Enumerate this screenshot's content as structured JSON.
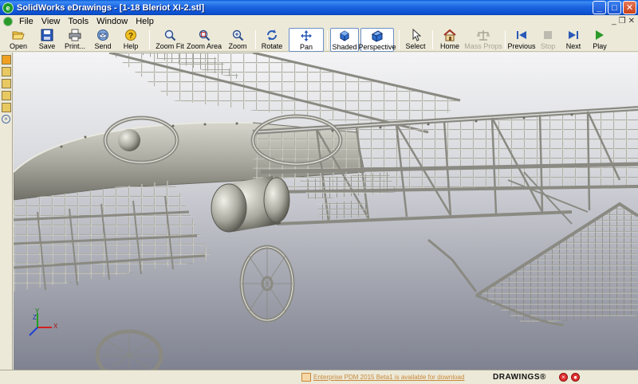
{
  "window": {
    "title": "SolidWorks eDrawings - [1-18 Bleriot XI-2.stl]",
    "app_icon": "edrawings-icon",
    "controls": [
      "minimize-icon",
      "maximize-icon",
      "close-icon"
    ]
  },
  "menu": {
    "items": [
      "File",
      "View",
      "Tools",
      "Window",
      "Help"
    ]
  },
  "toolbar": {
    "buttons": [
      {
        "label": "Open",
        "icon": "open-folder-icon"
      },
      {
        "label": "Save",
        "icon": "save-disk-icon"
      },
      {
        "label": "Print...",
        "icon": "printer-icon"
      },
      {
        "label": "Send",
        "icon": "send-mail-icon"
      },
      {
        "label": "Help",
        "icon": "help-icon"
      },
      {
        "label": "Zoom Fit",
        "icon": "zoom-fit-icon"
      },
      {
        "label": "Zoom Area",
        "icon": "zoom-area-icon"
      },
      {
        "label": "Zoom",
        "icon": "zoom-icon"
      },
      {
        "label": "Rotate",
        "icon": "rotate-icon"
      },
      {
        "label": "Pan",
        "icon": "pan-icon",
        "active": true
      },
      {
        "label": "Shaded",
        "icon": "shaded-cube-icon",
        "active": true
      },
      {
        "label": "Perspective",
        "icon": "perspective-cube-icon",
        "active": true
      },
      {
        "label": "Select",
        "icon": "select-arrow-icon"
      },
      {
        "label": "Home",
        "icon": "home-icon"
      },
      {
        "label": "Mass Props",
        "icon": "mass-props-icon",
        "disabled": true
      },
      {
        "label": "Previous",
        "icon": "previous-icon"
      },
      {
        "label": "Stop",
        "icon": "stop-icon",
        "disabled": true
      },
      {
        "label": "Next",
        "icon": "next-icon"
      },
      {
        "label": "Play",
        "icon": "play-icon"
      }
    ]
  },
  "left_panel": {
    "icons": [
      "components-icon",
      "markup-icon",
      "measure-icon",
      "sheets-icon",
      "stamp-icon"
    ],
    "expand_icon": "expand-chevrons-icon"
  },
  "viewport": {
    "model": "bleriot-xi-wireframe-model",
    "triad_axes": [
      "X",
      "Y",
      "Z"
    ],
    "colors": {
      "background_top": "#f4f4f6",
      "background_bottom": "#7f8290",
      "model": "#b8b8ae"
    }
  },
  "status": {
    "message": "Enterprise PDM 2015 Beta1 is available for download",
    "brand": "DRAWINGS®"
  }
}
